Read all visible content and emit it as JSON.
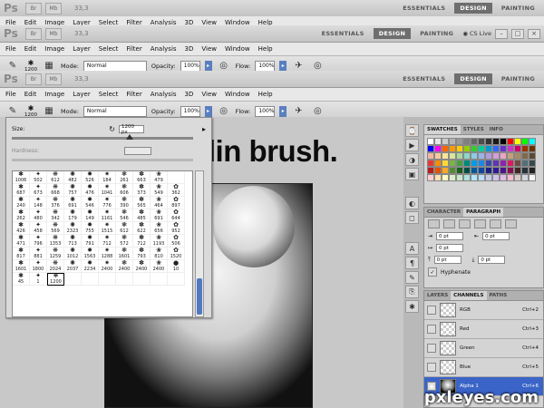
{
  "app": {
    "logo": "Ps",
    "app_buttons": [
      "Br",
      "Mb"
    ],
    "zoom": "33,3",
    "workspaces": [
      "ESSENTIALS",
      "DESIGN",
      "PAINTING"
    ],
    "active_workspace": "DESIGN",
    "cs_live": "CS Live",
    "window_controls": [
      "–",
      "□",
      "×"
    ]
  },
  "menu": [
    "File",
    "Edit",
    "Image",
    "Layer",
    "Select",
    "Filter",
    "Analysis",
    "3D",
    "View",
    "Window",
    "Help"
  ],
  "options": {
    "brush_size": "1200",
    "mode_label": "Mode:",
    "mode_value": "Normal",
    "opacity_label": "Opacity:",
    "opacity_value": "100%",
    "flow_label": "Flow:",
    "flow_value": "100%"
  },
  "brush_picker": {
    "size_label": "Size:",
    "size_value": "1200 px",
    "size_fraction": 0.65,
    "hardness_label": "Hardness:",
    "cells": [
      "1006",
      "502",
      "612",
      "482",
      "526",
      "184",
      "261",
      "663",
      "479",
      "",
      "687",
      "673",
      "668",
      "757",
      "476",
      "1041",
      "606",
      "373",
      "549",
      "362",
      "240",
      "148",
      "376",
      "691",
      "546",
      "776",
      "390",
      "565",
      "464",
      "897",
      "262",
      "480",
      "342",
      "179",
      "149",
      "1161",
      "546",
      "485",
      "691",
      "644",
      "426",
      "458",
      "569",
      "2323",
      "755",
      "1515",
      "612",
      "622",
      "656",
      "952",
      "471",
      "796",
      "1353",
      "713",
      "791",
      "712",
      "572",
      "712",
      "1193",
      "506",
      "817",
      "881",
      "1259",
      "1012",
      "1563",
      "1288",
      "1601",
      "793",
      "810",
      "1520",
      "1601",
      "1800",
      "2024",
      "2037",
      "2234",
      "2400",
      "2400",
      "2400",
      "2400",
      "10",
      "45",
      "1",
      "1200",
      "",
      "",
      "",
      "",
      "",
      "",
      ""
    ],
    "selected_index": 82
  },
  "canvas_title": "Merilin brush.",
  "swatches": {
    "tabs": [
      "SWATCHES",
      "STYLES",
      "INFO"
    ],
    "colors": [
      "#ffffff",
      "#e6e6e6",
      "#cccccc",
      "#b3b3b3",
      "#999999",
      "#808080",
      "#666666",
      "#4d4d4d",
      "#333333",
      "#1a1a1a",
      "#000000",
      "#ff0000",
      "#ffff00",
      "#00ff00",
      "#00ffff",
      "#0000ff",
      "#ff00ff",
      "#ff6600",
      "#ff9900",
      "#ffcc00",
      "#99cc00",
      "#33cc33",
      "#00cc99",
      "#0099cc",
      "#3366ff",
      "#6633cc",
      "#cc33cc",
      "#cc0066",
      "#993300",
      "#663300",
      "#f2b5a3",
      "#f7c99a",
      "#fbe49a",
      "#d9e69a",
      "#a8d9a0",
      "#8fd6c4",
      "#8ccbe8",
      "#9bb4e8",
      "#b39be0",
      "#d39ed9",
      "#eda3c4",
      "#c6a07a",
      "#a88a66",
      "#7f6a4d",
      "#5c4a33",
      "#e53935",
      "#fb8c00",
      "#fdd835",
      "#7cb342",
      "#43a047",
      "#00897b",
      "#039be5",
      "#1e88e5",
      "#3949ab",
      "#5e35b1",
      "#8e24aa",
      "#d81b60",
      "#6d4c41",
      "#546e7a",
      "#37474f",
      "#b71c1c",
      "#e65100",
      "#f9a825",
      "#558b2f",
      "#1b5e20",
      "#004d40",
      "#01579b",
      "#0d47a1",
      "#1a237e",
      "#311b92",
      "#4a148c",
      "#880e4f",
      "#3e2723",
      "#263238",
      "#212121",
      "#ffcdd2",
      "#ffe0b2",
      "#fff9c4",
      "#dcedc8",
      "#c8e6c9",
      "#b2dfdb",
      "#b3e5fc",
      "#bbdefb",
      "#c5cae9",
      "#d1c4e9",
      "#e1bee7",
      "#f8bbd0",
      "#d7ccc8",
      "#cfd8dc",
      "#f5f5f5"
    ]
  },
  "character": {
    "tabs": [
      "CHARACTER",
      "PARAGRAPH"
    ],
    "fields": [
      "0 pt",
      "0 pt",
      "0 pt",
      "0 pt",
      "0 pt"
    ],
    "hyphenate_label": "Hyphenate",
    "hyphenate_checked": true
  },
  "channels": {
    "tabs": [
      "LAYERS",
      "CHANNELS",
      "PATHS"
    ],
    "rows": [
      {
        "name": "RGB",
        "shortcut": "Ctrl+2"
      },
      {
        "name": "Red",
        "shortcut": "Ctrl+3"
      },
      {
        "name": "Green",
        "shortcut": "Ctrl+4"
      },
      {
        "name": "Blue",
        "shortcut": "Ctrl+5"
      },
      {
        "name": "Alpha 1",
        "shortcut": "Ctrl+6"
      }
    ]
  },
  "watermark": "pxleyes.com"
}
